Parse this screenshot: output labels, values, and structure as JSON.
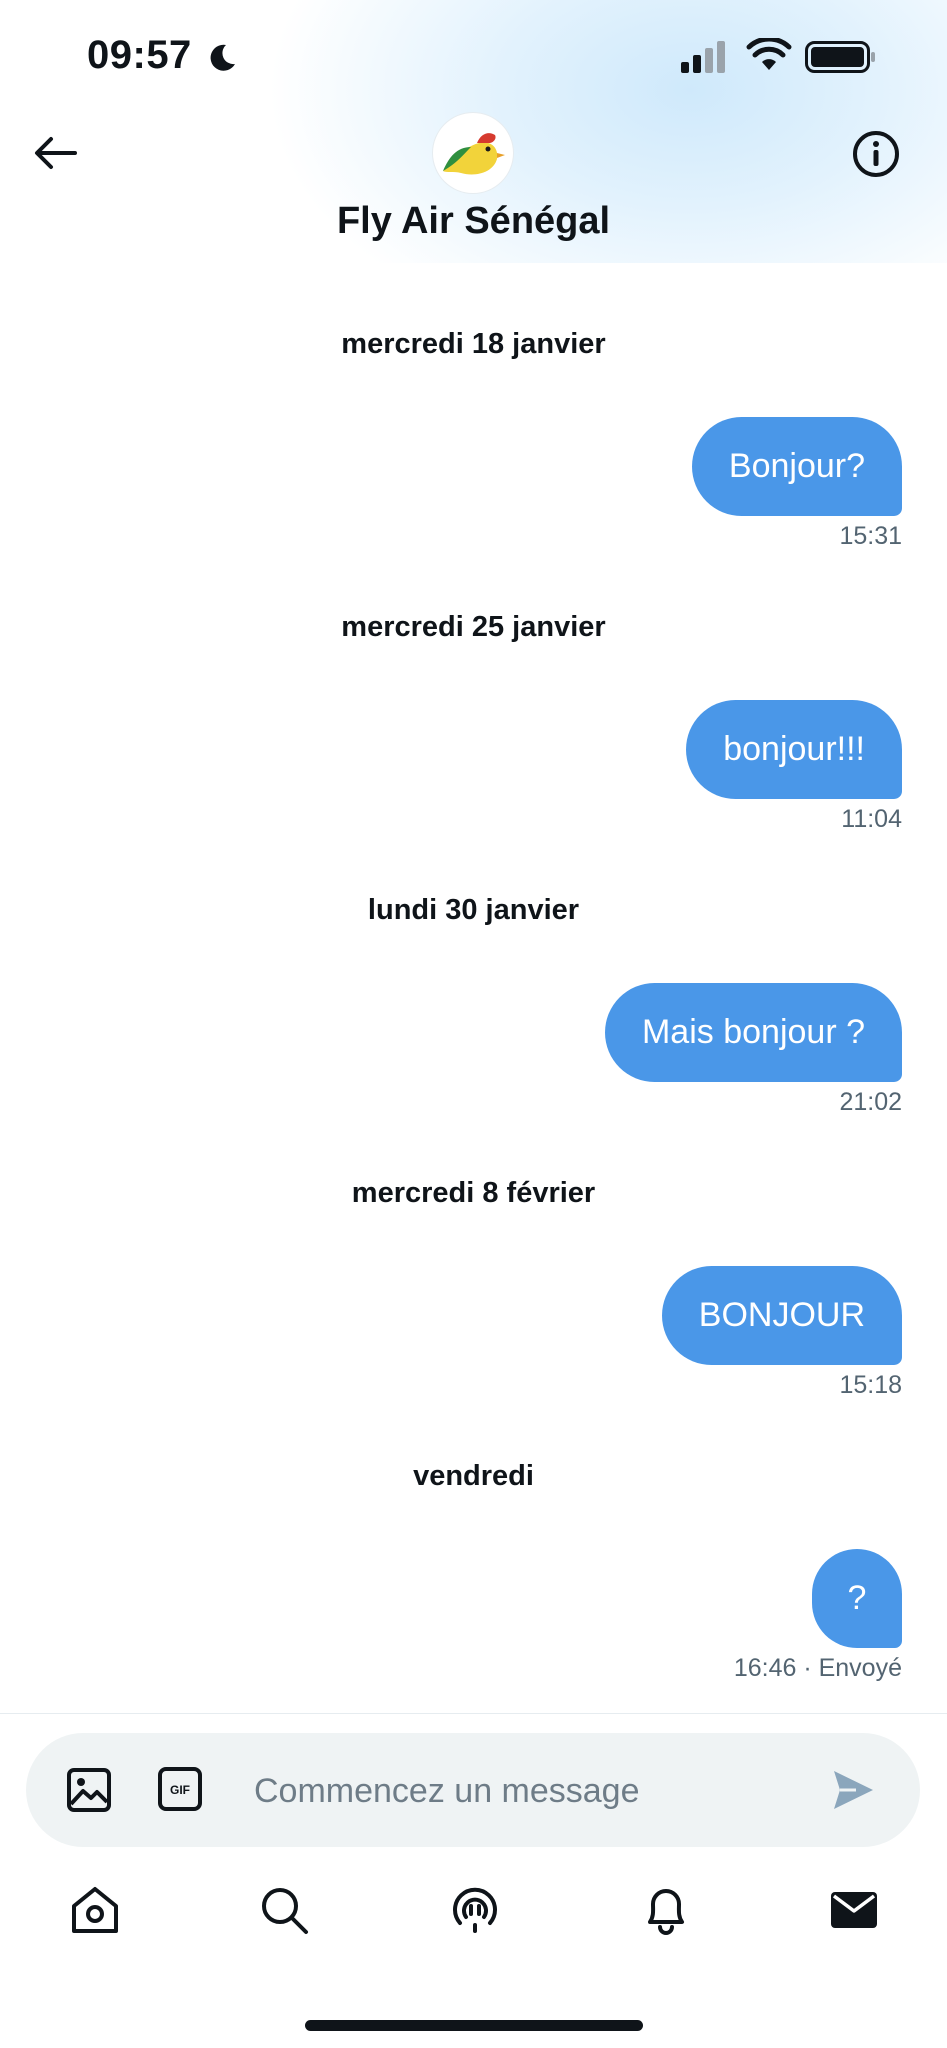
{
  "status_bar": {
    "time": "09:57"
  },
  "header": {
    "title": "Fly Air Sénégal"
  },
  "messages": [
    {
      "date": "mercredi 18 janvier",
      "text": "Bonjour?",
      "time": "15:31"
    },
    {
      "date": "mercredi 25 janvier",
      "text": "bonjour!!!",
      "time": "11:04"
    },
    {
      "date": "lundi 30 janvier",
      "text": "Mais bonjour ?",
      "time": "21:02"
    },
    {
      "date": "mercredi 8 février",
      "text": "BONJOUR",
      "time": "15:18"
    },
    {
      "date": "vendredi",
      "text": "?",
      "time": "16:46 · Envoyé"
    }
  ],
  "composer": {
    "placeholder": "Commencez un message",
    "gif_label": "GIF"
  },
  "colors": {
    "bubble": "#4a97e8",
    "text": "#0f1419",
    "muted": "#536471",
    "composer_bg": "#eff3f4"
  },
  "icons": {
    "back": "arrow-left-icon",
    "info": "info-icon",
    "image": "image-icon",
    "gif": "gif-icon",
    "send": "send-icon",
    "tabs": [
      "home-icon",
      "search-icon",
      "spaces-icon",
      "notifications-icon",
      "messages-icon"
    ]
  }
}
